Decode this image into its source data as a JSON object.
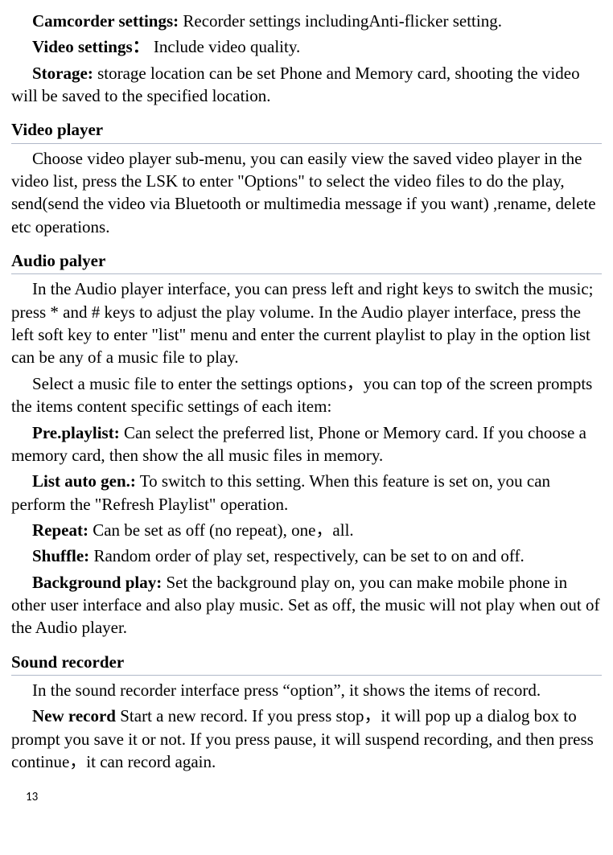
{
  "intro": {
    "camcorder": {
      "label": "Camcorder settings:",
      "text": "  Recorder settings includingAnti-flicker setting."
    },
    "video": {
      "label": "Video settings：",
      "text": " Include video quality."
    },
    "storage": {
      "label": "Storage:",
      "text": "  storage location can be set Phone and Memory card, shooting the video will be saved to the specified location."
    }
  },
  "sections": {
    "video_player": {
      "heading": "Video player",
      "p1": "Choose video player sub-menu, you can easily view the saved video player in the video list, press the LSK to enter \"Options\" to select the video files to do the play, send(send the video via Bluetooth or multimedia message if you want) ,rename, delete etc operations."
    },
    "audio_player": {
      "heading": "Audio palyer",
      "p1": "In the Audio player interface, you can press left and right keys to switch the music; press * and # keys to adjust the play volume. In the Audio player interface, press the left soft key to enter \"list\" menu and enter the current playlist to play in the option list can be any of a music file to play.",
      "p2": "Select a music file to enter the settings options，you can top of the screen prompts the items content specific settings of each item:",
      "pre_playlist": {
        "label": "Pre.playlist:",
        "text": "  Can select the preferred list, Phone or Memory card. If you choose a memory card, then show the all music files in memory."
      },
      "list_auto_gen": {
        "label": "List auto gen.:",
        "text": "  To switch to this setting. When this feature is set on, you can perform the \"Refresh Playlist\" operation."
      },
      "repeat": {
        "label": "Repeat:",
        "text": "  Can be set as off (no repeat), one，all."
      },
      "shuffle": {
        "label": "Shuffle:",
        "text": "  Random order of play set, respectively, can be set to on and off."
      },
      "background": {
        "label": "Background play:",
        "text": "  Set the background play on, you can make mobile phone in other user interface and also play music. Set as off, the music will not play when out of the Audio player."
      }
    },
    "sound_recorder": {
      "heading": "Sound recorder",
      "p1": "In the sound recorder interface press “option”, it shows the items of record.",
      "new_record": {
        "label": "New record",
        "text": "    Start a new record. If you press stop，it will pop up a dialog box to prompt you save it or not. If you press pause, it will suspend recording, and then press continue，it can record again."
      }
    }
  },
  "page_number": "13"
}
